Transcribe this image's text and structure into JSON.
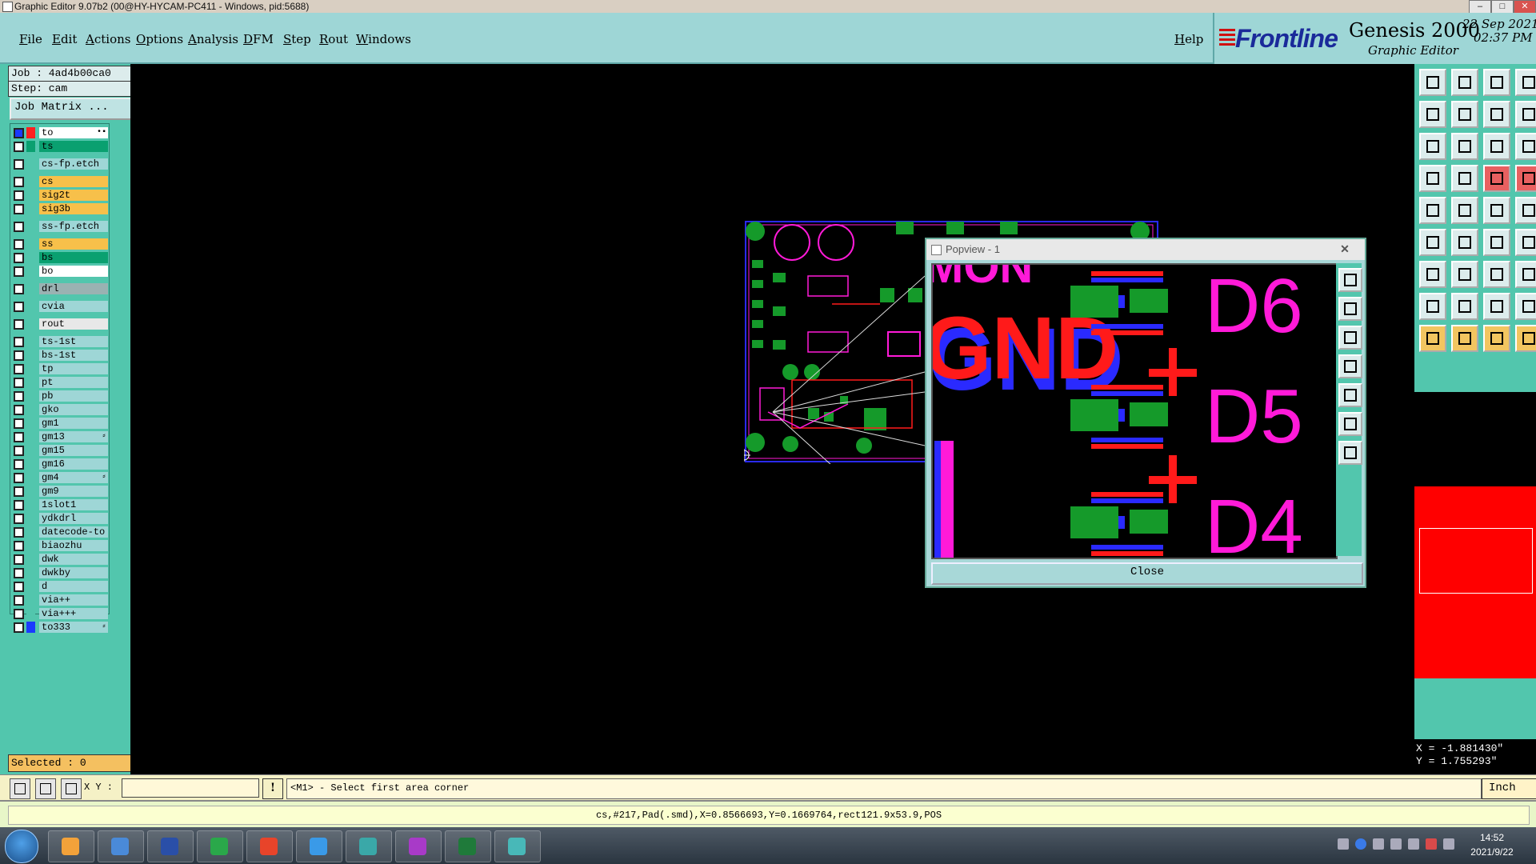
{
  "window": {
    "title": "Graphic Editor 9.07b2 (00@HY-HYCAM-PC411 - Windows, pid:5688)",
    "controls": [
      "–",
      "□",
      "✕"
    ]
  },
  "menu": {
    "items": [
      "File",
      "Edit",
      "Actions",
      "Options",
      "Analysis",
      "DFM",
      "Step",
      "Rout",
      "Windows"
    ],
    "help": "Help"
  },
  "brand": {
    "logo": "Frontline",
    "product": "Genesis 2000",
    "subtitle": "Graphic Editor",
    "date": "22 Sep 2021",
    "time": "02:37 PM"
  },
  "job": {
    "job_label": "Job : 4ad4b00ca0",
    "step_label": "Step: cam",
    "matrix_button": "Job Matrix ..."
  },
  "layers": [
    {
      "name": "to",
      "color": "#ffffff",
      "swatch": "#ff2020",
      "tag": "•▪",
      "cb": "#1a3aff"
    },
    {
      "name": "ts",
      "color": "#0aa070",
      "swatch": "#0aa070",
      "tag": "",
      "cb": ""
    },
    {
      "name": "cs-fp.etch",
      "color": "#9ed6d6",
      "swatch": "",
      "tag": "",
      "cb": ""
    },
    {
      "name": "cs",
      "color": "#f7c04a",
      "swatch": "",
      "tag": "",
      "cb": ""
    },
    {
      "name": "sig2t",
      "color": "#f7c04a",
      "swatch": "",
      "tag": "",
      "cb": ""
    },
    {
      "name": "sig3b",
      "color": "#f7c04a",
      "swatch": "",
      "tag": "",
      "cb": ""
    },
    {
      "name": "ss-fp.etch",
      "color": "#9ed6d6",
      "swatch": "",
      "tag": "",
      "cb": ""
    },
    {
      "name": "ss",
      "color": "#f7c04a",
      "swatch": "",
      "tag": "",
      "cb": ""
    },
    {
      "name": "bs",
      "color": "#0aa070",
      "swatch": "",
      "tag": "",
      "cb": ""
    },
    {
      "name": "bo",
      "color": "#ffffff",
      "swatch": "",
      "tag": "",
      "cb": ""
    },
    {
      "name": "drl",
      "color": "#9ab2b2",
      "swatch": "",
      "tag": "",
      "cb": ""
    },
    {
      "name": "cvia",
      "color": "#9ed6d6",
      "swatch": "",
      "tag": "",
      "cb": ""
    },
    {
      "name": "rout",
      "color": "#e8e8e8",
      "swatch": "",
      "tag": "",
      "cb": ""
    },
    {
      "name": "ts-1st",
      "color": "#9ed6d6",
      "swatch": "",
      "tag": "",
      "cb": ""
    },
    {
      "name": "bs-1st",
      "color": "#9ed6d6",
      "swatch": "",
      "tag": "",
      "cb": ""
    },
    {
      "name": "tp",
      "color": "#9ed6d6",
      "swatch": "",
      "tag": "",
      "cb": ""
    },
    {
      "name": "pt",
      "color": "#9ed6d6",
      "swatch": "",
      "tag": "",
      "cb": ""
    },
    {
      "name": "pb",
      "color": "#9ed6d6",
      "swatch": "",
      "tag": "",
      "cb": ""
    },
    {
      "name": "gko",
      "color": "#9ed6d6",
      "swatch": "",
      "tag": "",
      "cb": ""
    },
    {
      "name": "gm1",
      "color": "#9ed6d6",
      "swatch": "",
      "tag": "",
      "cb": ""
    },
    {
      "name": "gm13",
      "color": "#9ed6d6",
      "swatch": "",
      "tag": "⸗",
      "cb": ""
    },
    {
      "name": "gm15",
      "color": "#9ed6d6",
      "swatch": "",
      "tag": "",
      "cb": ""
    },
    {
      "name": "gm16",
      "color": "#9ed6d6",
      "swatch": "",
      "tag": "",
      "cb": ""
    },
    {
      "name": "gm4",
      "color": "#9ed6d6",
      "swatch": "",
      "tag": "⸗",
      "cb": ""
    },
    {
      "name": "gm9",
      "color": "#9ed6d6",
      "swatch": "",
      "tag": "",
      "cb": ""
    },
    {
      "name": "1slot1",
      "color": "#9ed6d6",
      "swatch": "",
      "tag": "",
      "cb": ""
    },
    {
      "name": "ydkdrl",
      "color": "#9ed6d6",
      "swatch": "",
      "tag": "",
      "cb": ""
    },
    {
      "name": "datecode-to",
      "color": "#9ed6d6",
      "swatch": "",
      "tag": "",
      "cb": ""
    },
    {
      "name": "biaozhu",
      "color": "#9ed6d6",
      "swatch": "",
      "tag": "",
      "cb": ""
    },
    {
      "name": "dwk",
      "color": "#9ed6d6",
      "swatch": "",
      "tag": "",
      "cb": ""
    },
    {
      "name": "dwkby",
      "color": "#9ed6d6",
      "swatch": "",
      "tag": "",
      "cb": ""
    },
    {
      "name": "d",
      "color": "#9ed6d6",
      "swatch": "",
      "tag": "",
      "cb": ""
    },
    {
      "name": "via++",
      "color": "#9ed6d6",
      "swatch": "",
      "tag": "",
      "cb": ""
    },
    {
      "name": "via+++",
      "color": "#9ed6d6",
      "swatch": "",
      "tag": "",
      "cb": ""
    },
    {
      "name": "to333",
      "color": "#9ed6d6",
      "swatch": "#1a3aff",
      "tag": "⸗",
      "cb": ""
    }
  ],
  "selected": "Selected : 0",
  "popview": {
    "title": "Popview - 1",
    "close_x": "✕",
    "close_button": "Close",
    "labels": [
      "D6",
      "D5",
      "D4"
    ],
    "fragments": [
      "MON",
      "GND"
    ]
  },
  "coords": {
    "x": "X = -1.881430\"",
    "y": "Y =  1.755293\""
  },
  "cmd": {
    "xy_label": "X Y :",
    "xy_value": "",
    "excl": "!",
    "prompt": "<M1> - Select first area corner",
    "units": "Inch"
  },
  "status": "cs,#217,Pad(.smd),X=0.8566693,Y=0.1669764,rect121.9x53.9,POS",
  "taskbar": {
    "time": "14:52",
    "date": "2021/9/22"
  },
  "colors": {
    "panel": "#52c6ad",
    "menubar": "#9ed6d6",
    "pad_green": "#159a2a",
    "silk_magenta": "#ff1ad8",
    "copper_red": "#ff1a1a",
    "trace_blue": "#2a2aff"
  }
}
